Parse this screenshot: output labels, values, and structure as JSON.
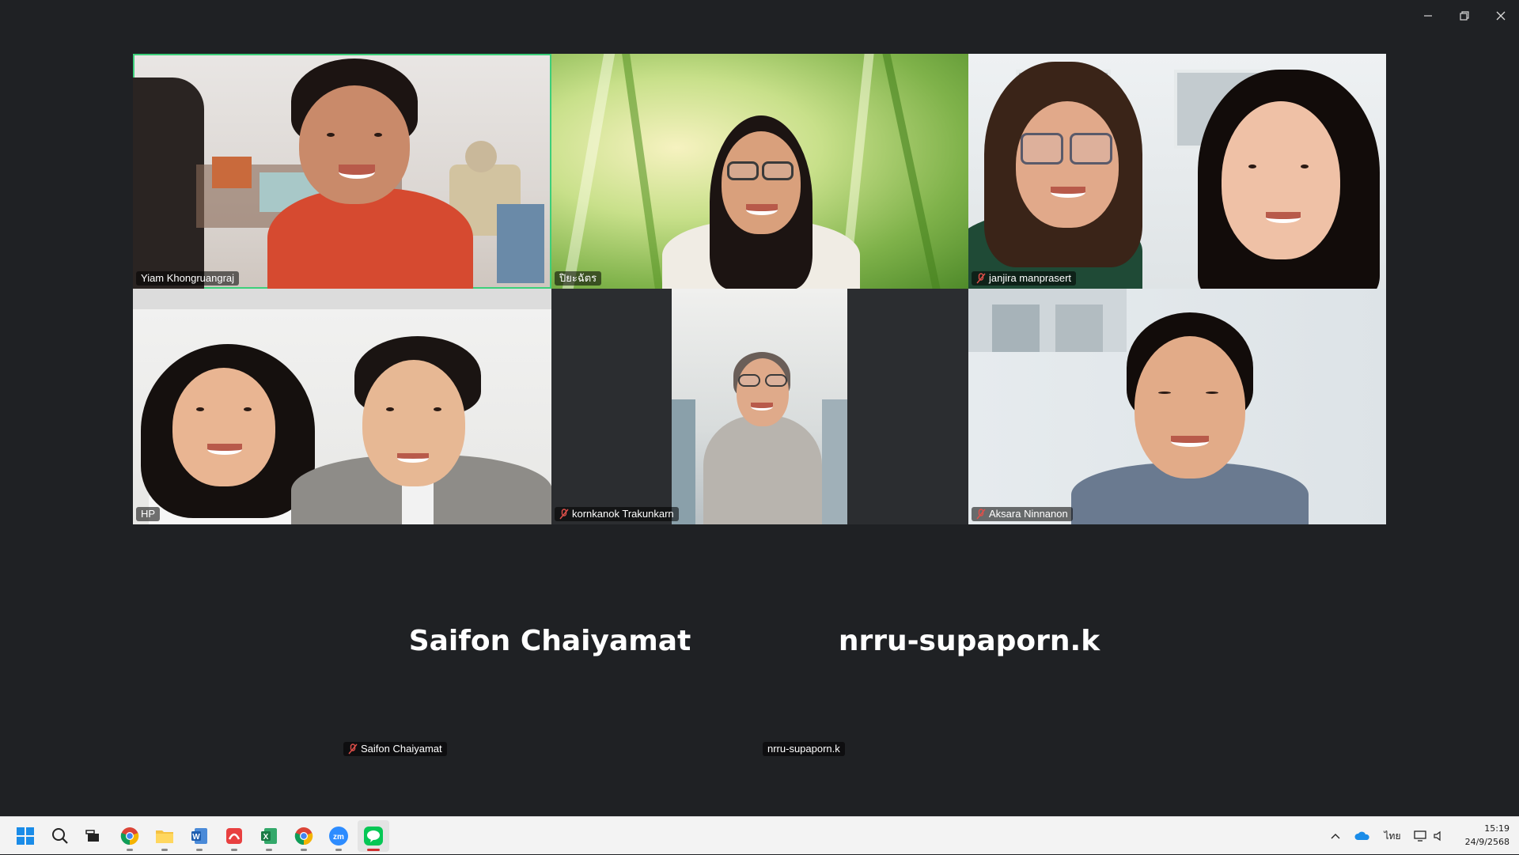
{
  "window": {
    "controls": {
      "minimize": "minimize-icon",
      "restore": "restore-icon",
      "close": "close-icon"
    }
  },
  "gallery": {
    "participants": [
      {
        "name": "Yiam Khongruangraj",
        "muted": false,
        "active_speaker": true
      },
      {
        "name": "ปิยะฉัตร",
        "muted": false,
        "active_speaker": false
      },
      {
        "name": "janjira manprasert",
        "muted": true,
        "active_speaker": false
      },
      {
        "name": "HP",
        "muted": false,
        "active_speaker": false
      },
      {
        "name": "kornkanok Trakunkarn",
        "muted": true,
        "active_speaker": false
      },
      {
        "name": "Aksara Ninnanon",
        "muted": true,
        "active_speaker": false
      }
    ],
    "video_off": [
      {
        "display_name": "Saifon Chaiyamat",
        "tag": "Saifon Chaiyamat",
        "muted": true
      },
      {
        "display_name": "nrru-supaporn.k",
        "tag": "nrru-supaporn.k",
        "muted": false
      }
    ]
  },
  "taskbar": {
    "apps": [
      "start-icon",
      "search-icon",
      "task-view-icon",
      "chrome-icon",
      "file-explorer-icon",
      "word-icon",
      "app-icon",
      "excel-icon",
      "chrome-icon",
      "zoom-icon",
      "line-icon"
    ],
    "tray": {
      "language": "ไทย"
    },
    "clock": {
      "time": "15:19",
      "date": "24/9/2568"
    }
  },
  "colors": {
    "active_speaker": "#3ccf7a",
    "background": "#1f2124",
    "taskbar": "#f3f3f3"
  }
}
